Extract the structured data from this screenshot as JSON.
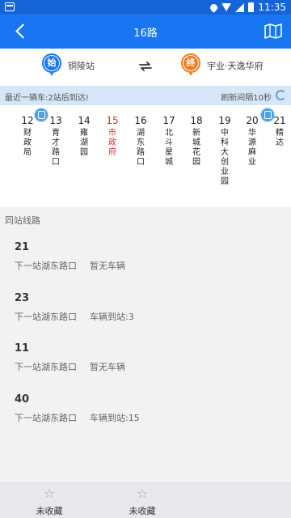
{
  "status_bar": {
    "time": "11:35"
  },
  "header": {
    "title": "16路"
  },
  "route": {
    "start_badge": "始",
    "start_stop": "铜陵站",
    "end_badge": "终",
    "end_stop": "宇业·天逸华府"
  },
  "arrival": {
    "message": "最近一辆车:2站后到达!",
    "refresh_text": "刷新间隔10秒"
  },
  "stops": [
    {
      "num": "12",
      "name": "财政局"
    },
    {
      "num": "13",
      "name": "育才路口"
    },
    {
      "num": "14",
      "name": "雍湖园"
    },
    {
      "num": "15",
      "name": "市政府",
      "current": true
    },
    {
      "num": "16",
      "name": "湖东路口"
    },
    {
      "num": "17",
      "name": "北斗星城"
    },
    {
      "num": "18",
      "name": "新城花园"
    },
    {
      "num": "19",
      "name": "中科大创业园"
    },
    {
      "num": "20",
      "name": "华源麻业"
    },
    {
      "num": "21",
      "name": "精达"
    }
  ],
  "same_station": {
    "title": "同站线路",
    "lines": [
      {
        "num": "21",
        "next": "下一站湖东路口",
        "status": "暂无车辆"
      },
      {
        "num": "23",
        "next": "下一站湖东路口",
        "status": "车辆到站:3"
      },
      {
        "num": "11",
        "next": "下一站湖东路口",
        "status": "暂无车辆"
      },
      {
        "num": "40",
        "next": "下一站湖东路口",
        "status": "车辆到站:15"
      }
    ]
  },
  "bottom": {
    "fav1_label": "未收藏",
    "fav2_label": "未收藏"
  },
  "icons": {
    "back": "back-arrow-icon",
    "map": "map-icon",
    "swap": "swap-icon",
    "refresh": "refresh-icon",
    "bus": "bus-icon",
    "star": "star-icon"
  },
  "colors": {
    "primary": "#1976f3",
    "start": "#1976f3",
    "end": "#f07d22",
    "current_stop": "#d32f2f",
    "arrival_bg": "#d4e6f8"
  }
}
